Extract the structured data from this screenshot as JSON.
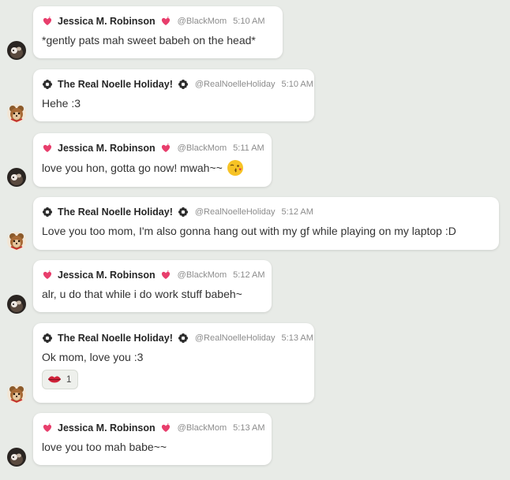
{
  "messages": [
    {
      "user": "jessica",
      "name": "Jessica M. Robinson",
      "handle": "@BlackMom",
      "time": "5:10 AM",
      "text": "*gently pats mah sweet babeh on the head*"
    },
    {
      "user": "noelle",
      "name": "The Real Noelle Holiday!",
      "handle": "@RealNoelleHoliday",
      "time": "5:10 AM",
      "text": "Hehe :3"
    },
    {
      "user": "jessica",
      "name": "Jessica M. Robinson",
      "handle": "@BlackMom",
      "time": "5:11 AM",
      "text": "love you hon, gotta go now! mwah~~",
      "emoji": "kiss-face-icon"
    },
    {
      "user": "noelle",
      "name": "The Real Noelle Holiday!",
      "handle": "@RealNoelleHoliday",
      "time": "5:12 AM",
      "text": "Love you too mom, I'm also gonna hang out with my gf while playing on my laptop :D"
    },
    {
      "user": "jessica",
      "name": "Jessica M. Robinson",
      "handle": "@BlackMom",
      "time": "5:12 AM",
      "text": "alr, u do that while i do work stuff babeh~"
    },
    {
      "user": "noelle",
      "name": "The Real Noelle Holiday!",
      "handle": "@RealNoelleHoliday",
      "time": "5:13 AM",
      "text": "Ok mom, love you :3",
      "reaction": {
        "icon": "lips-icon",
        "count": "1"
      }
    },
    {
      "user": "jessica",
      "name": "Jessica M. Robinson",
      "handle": "@BlackMom",
      "time": "5:13 AM",
      "text": "love you too mah babe~~"
    }
  ],
  "colors": {
    "background": "#e8ebe7",
    "bubble": "#ffffff",
    "heart": "#e83e6c",
    "meta": "#8c8c8c"
  }
}
